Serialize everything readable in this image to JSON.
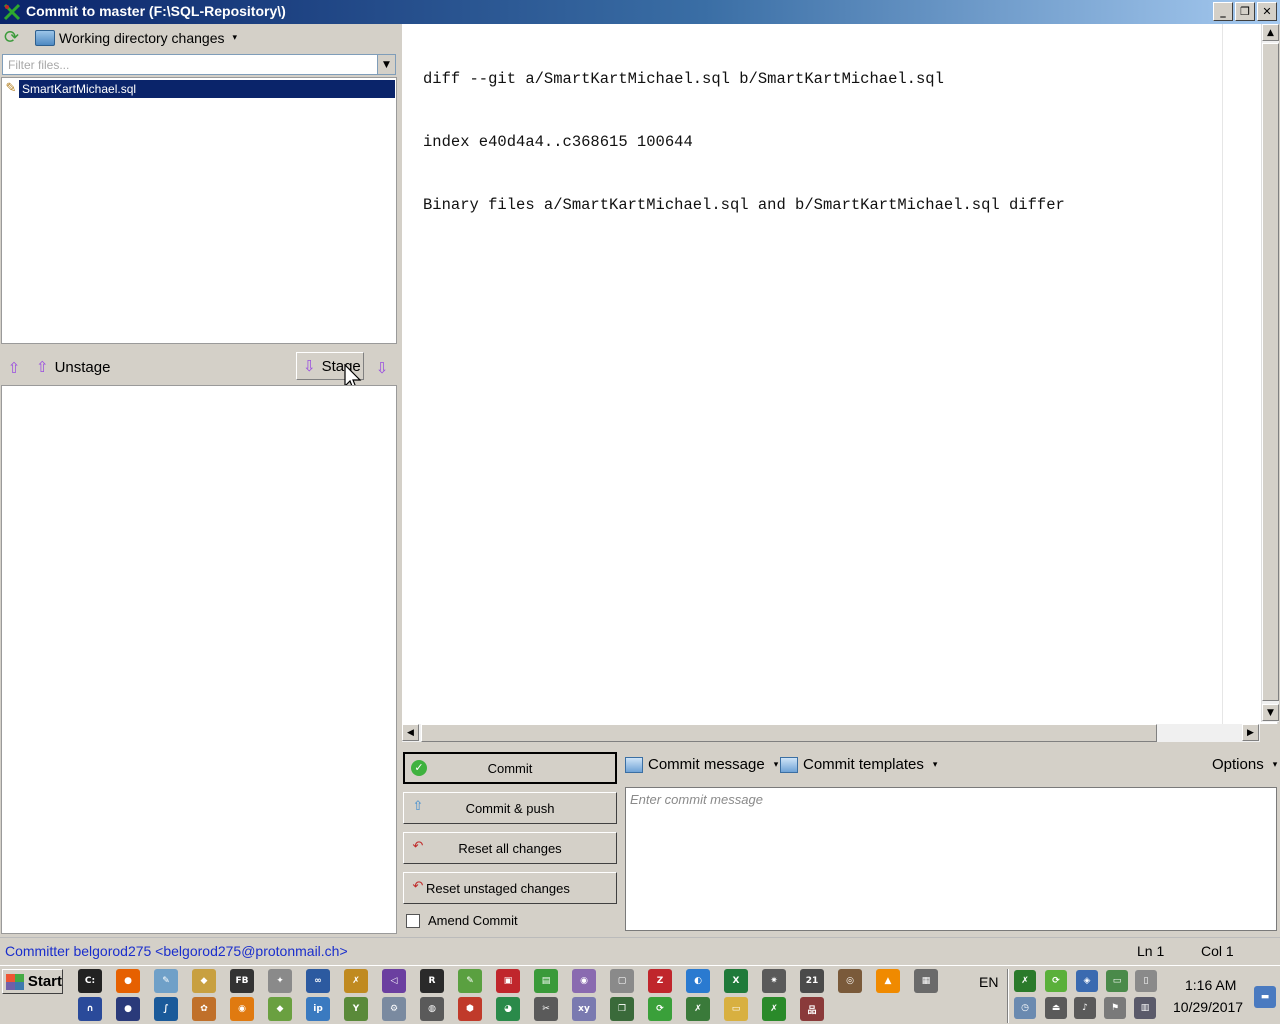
{
  "window": {
    "title": "Commit to master (F:\\SQL-Repository\\)",
    "controls": {
      "minimize": "_",
      "restore": "❐",
      "close": "✕"
    }
  },
  "left_toolbar": {
    "working_dir_label": "Working directory changes",
    "dropdown_caret": "▾"
  },
  "filter": {
    "placeholder": "Filter files...",
    "drop": "▼"
  },
  "unstaged_files": [
    {
      "name": "SmartKartMichael.sql",
      "icon": "pencil-icon",
      "selected": true
    }
  ],
  "stage_bar": {
    "unstage_label": "Unstage",
    "stage_label": "Stage",
    "up_arrow": "⇧",
    "down_arrow": "⇩"
  },
  "staged_files": [],
  "diff": {
    "lines": [
      "diff --git a/SmartKartMichael.sql b/SmartKartMichael.sql",
      "index e40d4a4..c368615 100644",
      "Binary files a/SmartKartMichael.sql and b/SmartKartMichael.sql differ"
    ]
  },
  "scroll": {
    "up": "▲",
    "down": "▼",
    "left": "◀",
    "right": "▶"
  },
  "commit_actions": {
    "commit": "Commit",
    "commit_push": "Commit & push",
    "reset_all": "Reset all changes",
    "reset_unstaged": "Reset unstaged changes",
    "amend": "Amend Commit",
    "amend_checked": false
  },
  "message_toolbar": {
    "commit_message": "Commit message",
    "commit_templates": "Commit templates",
    "options": "Options",
    "caret": "▾"
  },
  "message": {
    "placeholder": "Enter commit message",
    "value": ""
  },
  "status": {
    "committer": "Committer belgorod275 <belgorod275@protonmail.ch>",
    "ln": "Ln 1",
    "col": "Col 1"
  },
  "taskbar": {
    "start": "Start",
    "language": "EN",
    "time": "1:16 AM",
    "date": "10/29/2017",
    "row1_icons": [
      {
        "name": "console-icon",
        "color": "#222222",
        "glyph": "C:"
      },
      {
        "name": "firefox-icon",
        "color": "#e66000",
        "glyph": "●"
      },
      {
        "name": "notepad-icon",
        "color": "#6fa0c8",
        "glyph": "✎"
      },
      {
        "name": "explorer-icon",
        "color": "#c8a040",
        "glyph": "◆"
      },
      {
        "name": "fb-icon",
        "color": "#333333",
        "glyph": "FB"
      },
      {
        "name": "tools-icon",
        "color": "#8a8a8a",
        "glyph": "✦"
      },
      {
        "name": "link-icon",
        "color": "#2c5aa0",
        "glyph": "∞"
      },
      {
        "name": "chart-tool-icon",
        "color": "#c08a20",
        "glyph": "✗"
      },
      {
        "name": "visual-studio-icon",
        "color": "#6b3fa0",
        "glyph": "◁"
      },
      {
        "name": "r-icon",
        "color": "#2a2a2a",
        "glyph": "R"
      },
      {
        "name": "edit-icon",
        "color": "#5aa040",
        "glyph": "✎"
      },
      {
        "name": "save-icon",
        "color": "#c0262c",
        "glyph": "▣"
      },
      {
        "name": "sheet-icon",
        "color": "#3a9a3a",
        "glyph": "▤"
      },
      {
        "name": "disc-icon",
        "color": "#8a6ab0",
        "glyph": "◉"
      },
      {
        "name": "window-icon",
        "color": "#8a8a8a",
        "glyph": "▢"
      },
      {
        "name": "filezilla-icon",
        "color": "#c0262c",
        "glyph": "Z"
      },
      {
        "name": "globe-icon",
        "color": "#2a7ad0",
        "glyph": "◐"
      },
      {
        "name": "excel-icon",
        "color": "#1f7a3a",
        "glyph": "X"
      },
      {
        "name": "satellite-icon",
        "color": "#5a5a5a",
        "glyph": "✷"
      },
      {
        "name": "calendar-icon",
        "color": "#4a4a4a",
        "glyph": "21"
      },
      {
        "name": "film-icon",
        "color": "#7a5a3a",
        "glyph": "◎"
      },
      {
        "name": "vlc-icon",
        "color": "#f08a00",
        "glyph": "▲"
      },
      {
        "name": "map-icon",
        "color": "#6a6a6a",
        "glyph": "▦"
      }
    ],
    "row2_icons": [
      {
        "name": "headphones-icon",
        "color": "#2a4a9a",
        "glyph": "∩"
      },
      {
        "name": "sphere-icon",
        "color": "#2a3a7a",
        "glyph": "●"
      },
      {
        "name": "curve-icon",
        "color": "#1a5a9a",
        "glyph": "∫"
      },
      {
        "name": "paint-icon",
        "color": "#c0702a",
        "glyph": "✿"
      },
      {
        "name": "blender-icon",
        "color": "#e07a10",
        "glyph": "◉"
      },
      {
        "name": "diamond-icon",
        "color": "#6aa040",
        "glyph": "◆"
      },
      {
        "name": "ip-icon",
        "color": "#3a7ac0",
        "glyph": "ip"
      },
      {
        "name": "fork-icon",
        "color": "#5a8a3a",
        "glyph": "Y"
      },
      {
        "name": "tool-icon",
        "color": "#7a8aa0",
        "glyph": "⚙"
      },
      {
        "name": "ball-icon",
        "color": "#5a5a5a",
        "glyph": "◍"
      },
      {
        "name": "shield-icon",
        "color": "#c03a2a",
        "glyph": "⬢"
      },
      {
        "name": "earth-icon",
        "color": "#2a8a4a",
        "glyph": "◕"
      },
      {
        "name": "wrench-icon",
        "color": "#5a5a5a",
        "glyph": "✂"
      },
      {
        "name": "xy-icon",
        "color": "#7a7ab0",
        "glyph": "xy"
      },
      {
        "name": "copy-icon",
        "color": "#3a6a3a",
        "glyph": "❐"
      },
      {
        "name": "sync-icon",
        "color": "#3aa03a",
        "glyph": "⟳"
      },
      {
        "name": "git-extensions-icon",
        "color": "#3a7a3a",
        "glyph": "✗"
      },
      {
        "name": "folder-icon",
        "color": "#d8b040",
        "glyph": "▭"
      },
      {
        "name": "git-commit-icon",
        "color": "#2a8a2a",
        "glyph": "✗"
      },
      {
        "name": "app-icon",
        "color": "#8a3a3a",
        "glyph": "品"
      }
    ],
    "tray_icons": [
      {
        "name": "tray-git-icon",
        "color": "#2a7a2a",
        "glyph": "✗"
      },
      {
        "name": "tray-sync-icon",
        "color": "#5ab03a",
        "glyph": "⟳"
      },
      {
        "name": "tray-network-icon",
        "color": "#3a6ab0",
        "glyph": "◈"
      },
      {
        "name": "tray-monitor-icon",
        "color": "#4a8a4a",
        "glyph": "▭"
      },
      {
        "name": "tray-mouse-icon",
        "color": "#8a8a8a",
        "glyph": "▯"
      },
      {
        "name": "tray-clock-icon",
        "color": "#6a8ab0",
        "glyph": "◷"
      },
      {
        "name": "tray-usb-icon",
        "color": "#5a5a5a",
        "glyph": "⏏"
      },
      {
        "name": "tray-volume-icon",
        "color": "#5a5a5a",
        "glyph": "♪"
      },
      {
        "name": "tray-flag-icon",
        "color": "#7a7a7a",
        "glyph": "⚑"
      },
      {
        "name": "tray-display-icon",
        "color": "#5a5a6a",
        "glyph": "▥"
      },
      {
        "name": "show-desktop-icon",
        "color": "#4a7ac0",
        "glyph": "▬"
      }
    ]
  }
}
